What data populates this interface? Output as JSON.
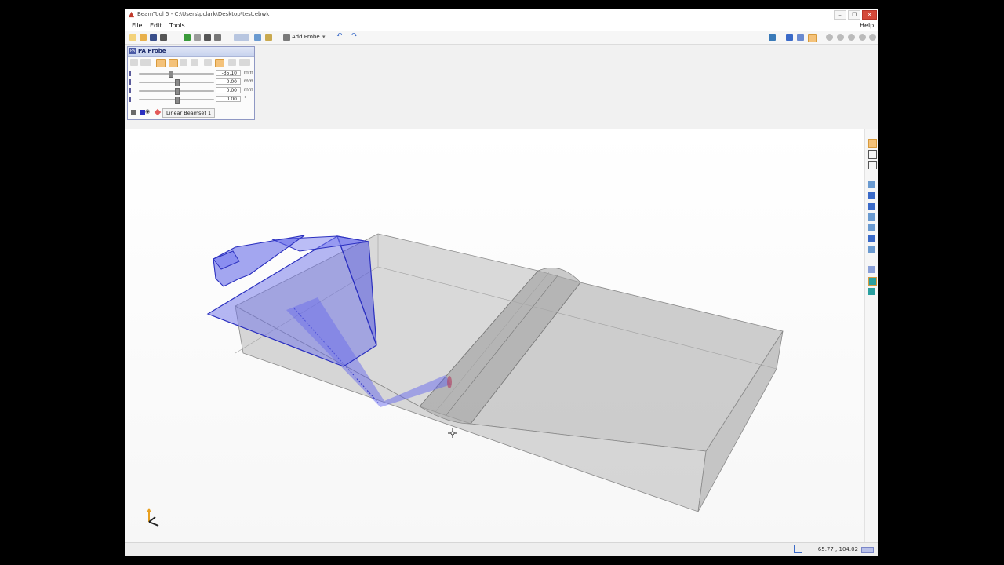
{
  "window": {
    "title": "BeamTool 5 - C:\\Users\\pclark\\Desktop\\test.ebwk"
  },
  "menus": [
    "File",
    "Edit",
    "Tools"
  ],
  "help_label": "Help",
  "toolbar": {
    "add_probe_label": "Add Probe"
  },
  "probe_panel": {
    "title": "PA Probe",
    "sliders": [
      {
        "value": "-35.10",
        "unit": "mm",
        "fraction": 0.42
      },
      {
        "value": "0.00",
        "unit": "mm",
        "fraction": 0.5
      },
      {
        "value": "0.00",
        "unit": "mm",
        "fraction": 0.5
      },
      {
        "value": "0.00",
        "unit": "°",
        "fraction": 0.5
      }
    ],
    "beamset_label": "Linear Beamset 1"
  },
  "status": {
    "coordinates": "65.77 , 104.02"
  },
  "colors": {
    "probe": "#3c40d8",
    "part": "#a9a9a9",
    "accent": "#f4c27a"
  }
}
